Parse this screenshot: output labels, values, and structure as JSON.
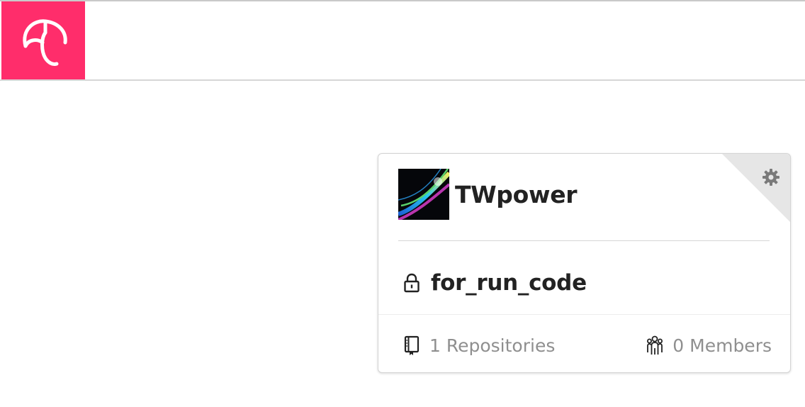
{
  "app": {
    "logo": "umbrella-logo",
    "brand_color": "#ff2d6b"
  },
  "org_card": {
    "name": "TWpower",
    "avatar": "aurora-avatar",
    "settings_icon": "gear-icon",
    "repo": {
      "name": "for_run_code",
      "visibility_icon": "lock-icon"
    },
    "stats": {
      "repositories_label": "1 Repositories",
      "members_label": "0 Members"
    },
    "colors": {
      "text": "#222222",
      "muted": "#8f8f8f",
      "corner": "#e6e6e6"
    }
  }
}
